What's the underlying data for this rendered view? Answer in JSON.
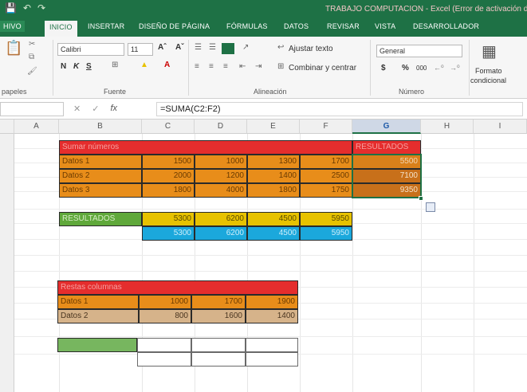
{
  "window": {
    "title": "TRABAJO COMPUTACION - Excel (Error de activación de p"
  },
  "tabs": [
    {
      "label": "HIVO"
    },
    {
      "label": "INICIO"
    },
    {
      "label": "INSERTAR"
    },
    {
      "label": "DISEÑO DE PÁGINA"
    },
    {
      "label": "FÓRMULAS"
    },
    {
      "label": "DATOS"
    },
    {
      "label": "REVISAR"
    },
    {
      "label": "VISTA"
    },
    {
      "label": "DESARROLLADOR"
    }
  ],
  "ribbon": {
    "clipboard_label": "papeles",
    "font_name": "Calibri",
    "font_size": "11",
    "bold": "N",
    "italic": "K",
    "underline": "S",
    "font_group_label": "Fuente",
    "wrap_text": "Ajustar texto",
    "merge_center": "Combinar y centrar",
    "align_group_label": "Alineación",
    "number_format": "General",
    "currency": "$",
    "percent": "%",
    "thousands": "000",
    "number_group_label": "Número",
    "conditional_format": "Formato",
    "conditional_format_2": "condicional",
    "accent_color": "#1e7145"
  },
  "formula_bar": {
    "fx": "fx",
    "formula": "=SUMA(C2:F2)"
  },
  "columns": [
    "A",
    "B",
    "C",
    "D",
    "E",
    "F",
    "G",
    "H",
    "I"
  ],
  "selected_column": "G",
  "table_sum": {
    "header": "Sumar números",
    "rows": [
      {
        "label": "Datos 1",
        "values": [
          "1500",
          "1000",
          "1300",
          "1700"
        ]
      },
      {
        "label": "Datos 2",
        "values": [
          "2000",
          "1200",
          "1400",
          "2500"
        ]
      },
      {
        "label": "Datos 3",
        "values": [
          "1800",
          "4000",
          "1800",
          "1750"
        ]
      }
    ],
    "results_header": "RESULTADOS",
    "results": [
      "5500",
      "7100",
      "9350"
    ]
  },
  "col_results": {
    "label": "RESULTADOS",
    "row1": [
      "5300",
      "6200",
      "4500",
      "5950"
    ],
    "row2": [
      "5300",
      "6200",
      "4500",
      "5950"
    ]
  },
  "table_sub": {
    "header": "Restas columnas",
    "rows": [
      {
        "label": "Datos 1",
        "values": [
          "1000",
          "1700",
          "1900"
        ]
      },
      {
        "label": "Datos 2",
        "values": [
          "800",
          "1600",
          "1400"
        ]
      }
    ]
  }
}
